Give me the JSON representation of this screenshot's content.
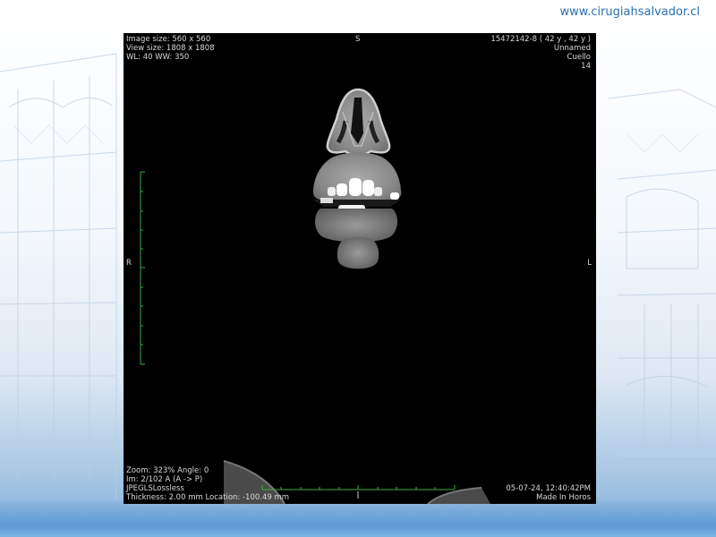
{
  "website": "www.cirugiahsalvador.cl",
  "viewer": {
    "top_left": [
      "Image size: 560 x 560",
      "View size: 1808 x 1808",
      "WL: 40 WW: 350"
    ],
    "top_right": [
      "15472142-8 (  42 y ,  42 y )",
      "Unnamed",
      "Cuello",
      "14"
    ],
    "bottom_left": [
      "Zoom: 323% Angle: 0",
      "Im: 2/102  A (A -> P)",
      "JPEGLSLossless",
      "Thickness: 2.00 mm Location: -100.49 mm"
    ],
    "bottom_right": [
      "05-07-24, 12:40:42PM",
      "Made In Horos"
    ],
    "orientation": {
      "top": "S",
      "right_side": "R",
      "left_side": "L"
    }
  }
}
